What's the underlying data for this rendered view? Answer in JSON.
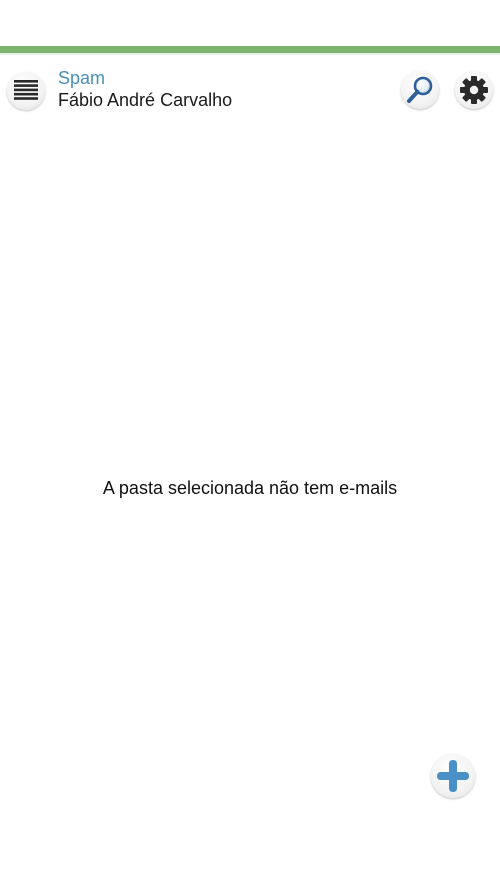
{
  "header": {
    "folder_name": "Spam",
    "account_name": "Fábio André Carvalho"
  },
  "main": {
    "empty_message": "A pasta selecionada não tem e-mails"
  },
  "icons": {
    "menu": "menu-lines-icon",
    "search": "magnifier-icon",
    "settings": "gear-icon",
    "compose": "plus-icon"
  },
  "colors": {
    "accent_bar": "#7cb46e",
    "folder_text": "#4a90b8",
    "compose_plus": "#4a90c8"
  }
}
